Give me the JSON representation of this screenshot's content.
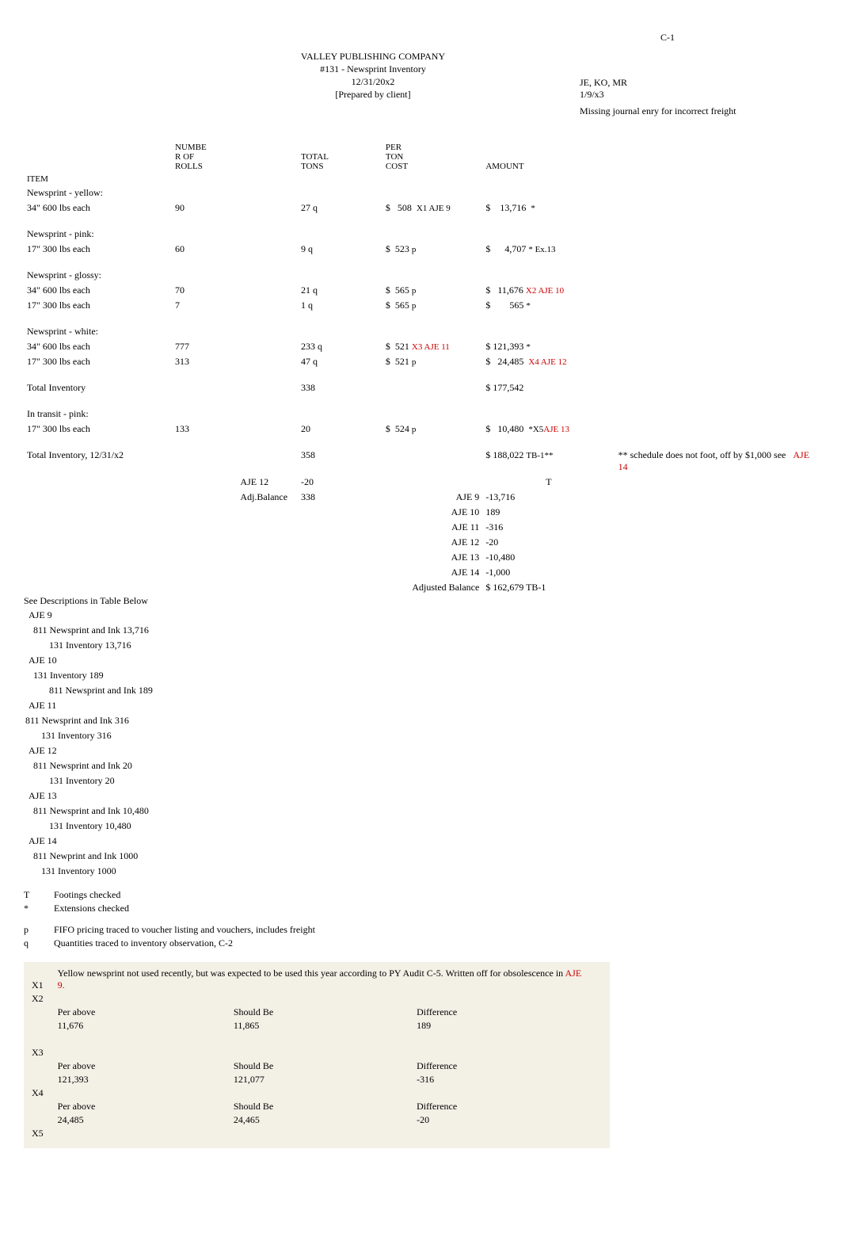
{
  "header": {
    "c1": "C-1",
    "company": "VALLEY PUBLISHING COMPANY",
    "doc": "#131 - Newsprint Inventory",
    "date": "12/31/20x2",
    "prepared": "[Prepared by client]",
    "initials": "JE, KO, MR",
    "initials_date": "1/9/x3",
    "missing": "Missing journal enry for incorrect freight"
  },
  "cols": {
    "item": "ITEM",
    "numbe": "NUMBE",
    "rof": "R OF",
    "rolls": "ROLLS",
    "total": "TOTAL",
    "tons": "TONS",
    "per": "PER",
    "ton": "TON",
    "cost": "COST",
    "amount": "AMOUNT"
  },
  "sections": {
    "yellow": "Newsprint - yellow:",
    "pink": "Newsprint - pink:",
    "glossy": "Newsprint - glossy:",
    "white": "Newsprint - white:",
    "total_inv": "Total Inventory",
    "in_transit": "In transit - pink:",
    "total_inventory": "Total Inventory, 12/31/x2",
    "aje12_label": "AJE 12",
    "adj_balance_label": "Adj.Balance"
  },
  "rows": {
    "yellow_34": {
      "desc": "34\" 600 lbs each",
      "rolls": "90",
      "tons": "27 q",
      "cost_sym": "$",
      "cost": "508",
      "cost_mark": "X1 AJE 9",
      "amt_sym": "$",
      "amt": "13,716",
      "amt_mark": "*"
    },
    "pink_17": {
      "desc": "17\" 300 lbs each",
      "rolls": "60",
      "tons": "9 q",
      "cost_sym": "$",
      "cost": "523",
      "cost_mark": "p",
      "amt_sym": "$",
      "amt": "4,707",
      "amt_mark": "* Ex.13"
    },
    "glossy_34": {
      "desc": "34\" 600 lbs each",
      "rolls": "70",
      "tons": "21 q",
      "cost_sym": "$",
      "cost": "565",
      "cost_mark": "p",
      "amt_sym": "$",
      "amt": "11,676",
      "amt_mark_red": "X2 AJE 10"
    },
    "glossy_17": {
      "desc": "17\" 300 lbs each",
      "rolls": "7",
      "tons": "1 q",
      "cost_sym": "$",
      "cost": "565",
      "cost_mark": "p",
      "amt_sym": "$",
      "amt": "565",
      "amt_mark": "*"
    },
    "white_34": {
      "desc": "34\" 600 lbs each",
      "rolls": "777",
      "tons": "233 q",
      "cost_sym": "$",
      "cost": "521",
      "cost_mark_red": "X3 AJE 11",
      "amt_sym": "$",
      "amt": "121,393",
      "amt_mark": "*"
    },
    "white_17": {
      "desc": "17\" 300 lbs each",
      "rolls": "313",
      "tons": "47 q",
      "cost_sym": "$",
      "cost": "521",
      "cost_mark": "p",
      "amt_sym": "$",
      "amt": "24,485",
      "amt_mark_red": "X4 AJE 12"
    },
    "total_inv": {
      "tons": "338",
      "amt_sym": "$",
      "amt": "177,542"
    },
    "transit_17": {
      "desc": "17\" 300 lbs each",
      "rolls": "133",
      "tons": "20",
      "cost_sym": "$",
      "cost": "524",
      "cost_mark": "p",
      "amt_sym": "$",
      "amt": "10,480",
      "amt_mark": "*X5",
      "amt_mark_red": "AJE 13"
    },
    "total": {
      "tons": "358",
      "amt_sym": "$",
      "amt": "188,022",
      "amt_mark": "TB-1**"
    },
    "aje12_row": {
      "tons": "-20",
      "mark_label": "T"
    },
    "adj_bal": {
      "tons": "338"
    }
  },
  "schedule_note": "** schedule does not foot, off by $1,000 see",
  "schedule_note_red": "AJE 14",
  "adjustments": [
    {
      "label": "AJE 9",
      "val": "-13,716"
    },
    {
      "label": "AJE 10",
      "val": "189"
    },
    {
      "label": "AJE 11",
      "val": "-316"
    },
    {
      "label": "AJE 12",
      "val": "-20"
    },
    {
      "label": "AJE 13",
      "val": "-10,480"
    },
    {
      "label": "AJE 14",
      "val": "-1,000"
    }
  ],
  "adjusted_balance_label": "Adjusted Balance",
  "adjusted_balance_value": "$  162,679  TB-1",
  "see_desc": "See Descriptions in Table Below",
  "aje_entries": {
    "aje9_h": "AJE 9",
    "aje9_a": "811 Newsprint and Ink     13,716",
    "aje9_b": "131      Inventory                    13,716",
    "aje10_h": "AJE 10",
    "aje10_a": "131 Inventory                  189",
    "aje10_b": "811      Newsprint and Ink         189",
    "aje11_h": "AJE 11",
    "aje11_a": "811 Newsprint and Ink      316",
    "aje11_b": "131      Inventory              316",
    "aje12_h": "AJE 12",
    "aje12_a": "811 Newsprint and Ink      20",
    "aje12_b": "131      Inventory              20",
    "aje13_h": "AJE 13",
    "aje13_a": "811 Newsprint and Ink      10,480",
    "aje13_b": "131      Inventory                 10,480",
    "aje14_h": "AJE 14",
    "aje14_a": "811 Newprint and Ink        1000",
    "aje14_b": "131 Inventory                     1000"
  },
  "tickmarks": {
    "T": "Footings checked",
    "star": "Extensions checked",
    "p": "FIFO pricing traced to voucher listing and vouchers, includes freight",
    "q": "Quantities traced to inventory observation, C-2"
  },
  "x_notes": {
    "x1_pre": "Yellow newsprint not used recently, but was expected to be used this year according to PY Audit C-5. Written off for obsolescence in ",
    "x1_red": "AJE 9.",
    "X1": "X1",
    "X2": "X2",
    "per_above": "Per above",
    "should_be": "Should Be",
    "difference": "Difference",
    "x2_a": "11,676",
    "x2_b": "11,865",
    "x2_c": "189",
    "X3": "X3",
    "x3_a": "121,393",
    "x3_b": "121,077",
    "x3_c": "-316",
    "X4": "X4",
    "x4_a": "24,485",
    "x4_b": "24,465",
    "x4_c": "-20",
    "X5": "X5"
  }
}
